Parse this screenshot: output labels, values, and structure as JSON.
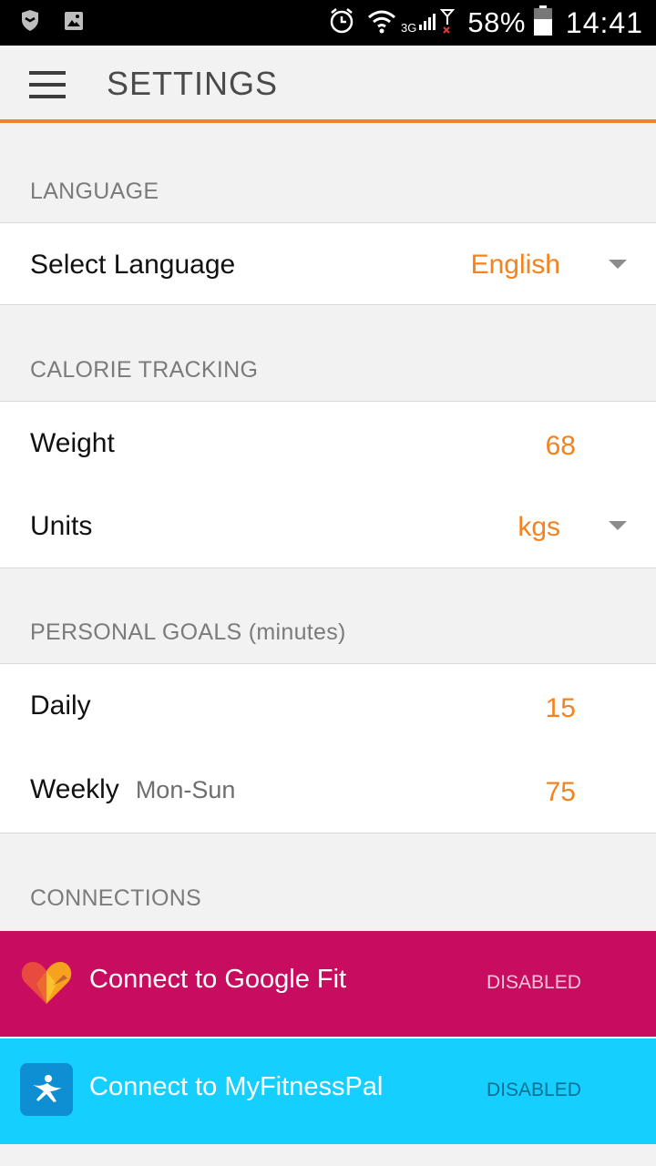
{
  "status_bar": {
    "network": "3G",
    "battery_percent": "58%",
    "time": "14:41"
  },
  "app_bar": {
    "title": "SETTINGS"
  },
  "sections": {
    "language": {
      "header": "LANGUAGE",
      "select_label": "Select Language",
      "select_value": "English"
    },
    "calorie": {
      "header": "CALORIE TRACKING",
      "weight_label": "Weight",
      "weight_value": "68",
      "units_label": "Units",
      "units_value": "kgs"
    },
    "goals": {
      "header": "PERSONAL GOALS",
      "header_sub": "(minutes)",
      "daily_label": "Daily",
      "daily_value": "15",
      "weekly_label": "Weekly",
      "weekly_sub": "Mon-Sun",
      "weekly_value": "75"
    },
    "connections": {
      "header": "CONNECTIONS",
      "google_fit_label": "Connect to Google Fit",
      "google_fit_status": "DISABLED",
      "mfp_label": "Connect to MyFitnessPal",
      "mfp_status": "DISABLED"
    }
  },
  "colors": {
    "accent": "#f5821f",
    "google_fit_bg": "#c80d60",
    "mfp_bg": "#14cfff",
    "mfp_icon_bg": "#0e8fd4"
  }
}
